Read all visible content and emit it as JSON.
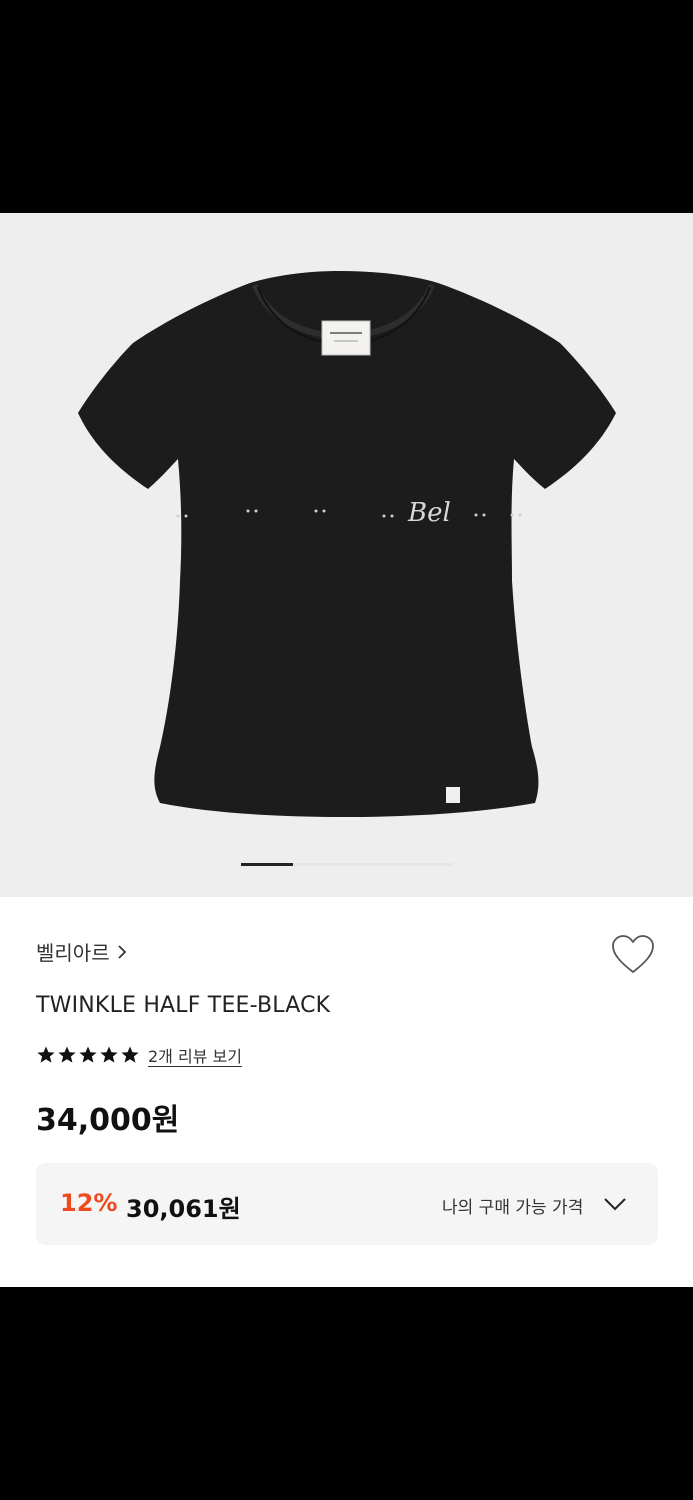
{
  "product": {
    "brand": "벨리아르",
    "title": "TWINKLE HALF TEE-BLACK",
    "rating_stars": 5,
    "review_link": "2개 리뷰 보기",
    "price": "34,000원",
    "discount": "12%",
    "sale_price": "30,061원",
    "my_price_label": "나의 구매 가능 가격",
    "logo_text": "Bel"
  },
  "gallery": {
    "current_image": 1
  },
  "icons": {
    "wishlist": "heart-outline-icon",
    "brand_link": "chevron-right-icon",
    "expand": "chevron-down-icon",
    "rating": "star-icon"
  },
  "colors": {
    "discount": "#ee4a20",
    "background_gallery": "#eeeeee",
    "box": "#f5f5f5"
  }
}
